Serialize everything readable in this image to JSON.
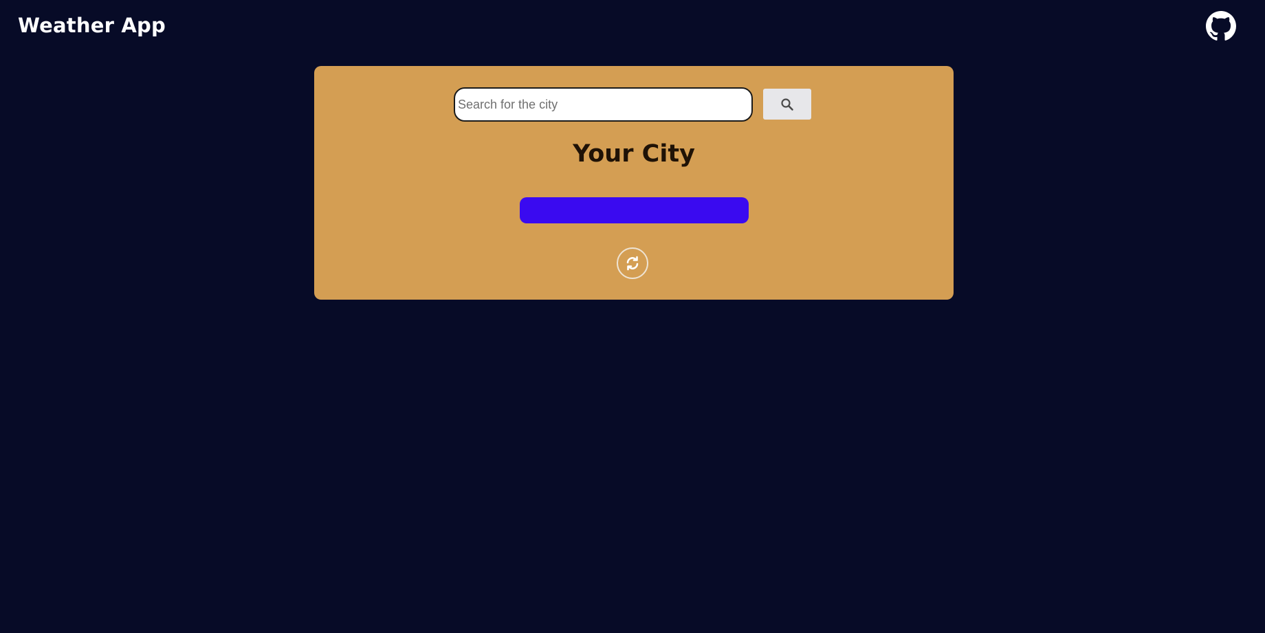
{
  "header": {
    "title": "Weather App",
    "github_icon": "github-icon"
  },
  "search": {
    "placeholder": "Search for the city",
    "value": "",
    "button_icon": "search-icon"
  },
  "weather": {
    "city": "Your City",
    "refresh_icon": "refresh-icon"
  },
  "colors": {
    "background": "#070b27",
    "card": "#d49e53",
    "accent_bar": "#3a0af0",
    "search_button": "#e7e7ea"
  }
}
